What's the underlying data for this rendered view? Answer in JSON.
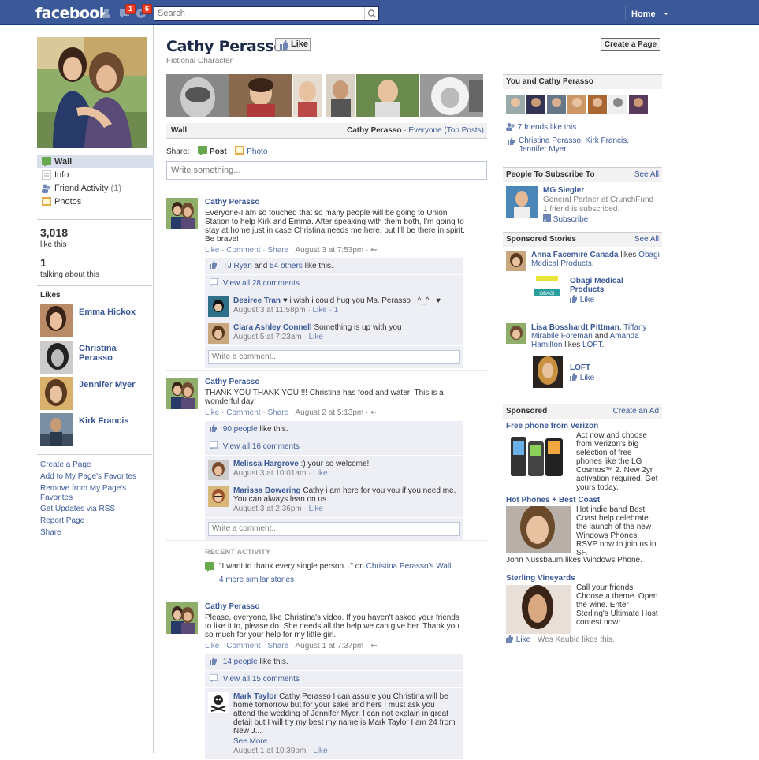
{
  "topbar": {
    "logo": "facebook",
    "badges": [
      "1",
      "6"
    ],
    "search_placeholder": "Search",
    "home": "Home"
  },
  "left": {
    "nav": [
      {
        "label": "Wall",
        "count": ""
      },
      {
        "label": "Info",
        "count": ""
      },
      {
        "label": "Friend Activity",
        "count": "(1)"
      },
      {
        "label": "Photos",
        "count": ""
      }
    ],
    "likes_count": "3,018",
    "likes_label": "like this",
    "talking_count": "1",
    "talking_label": "talking about this",
    "likes_heading": "Likes",
    "liked_pages": [
      "Emma Hickox",
      "Christina Perasso",
      "Jennifer Myer",
      "Kirk Francis"
    ],
    "links": [
      "Create a Page",
      "Add to My Page's Favorites",
      "Remove from My Page's Favorites",
      "Get Updates via RSS",
      "Report Page",
      "Share"
    ]
  },
  "header": {
    "name": "Cathy Perasso",
    "category": "Fictional Character",
    "like_button": "Like"
  },
  "wall": {
    "title": "Wall",
    "filter_name": "Cathy Perasso",
    "filter_sep": " · ",
    "filter_option": "Everyone (Top Posts)",
    "share_label": "Share:",
    "share_post": "Post",
    "share_photo": "Photo",
    "composer_placeholder": "Write something...",
    "write_comment": "Write a comment..."
  },
  "posts": [
    {
      "author": "Cathy Perasso",
      "text": "Everyone-I am so touched that so many people will be going to Union Station to help Kirk and Emma. After speaking with them both, I'm going to stay at home just in case Christina needs me here, but I'll be there in spirit. Be brave!",
      "actions": "Like · Comment · Share · ",
      "time": "August 3 at 7:53pm · ",
      "likes_a": "TJ Ryan",
      "likes_and": " and ",
      "likes_b": "54 others",
      "likes_tail": " like this.",
      "view_all": "View all 28 comments",
      "comments": [
        {
          "author": "Desiree Tran",
          "text": " ♥ i wish i could hug you Ms. Perasso ~^_^~ ♥",
          "time": "August 3 at 11:58pm · ",
          "action": "Like",
          "extra": " · 1"
        },
        {
          "author": "Ciara Ashley Connell",
          "text": " Something is up with you",
          "time": "August 5 at 7:23am · ",
          "action": "Like",
          "extra": ""
        }
      ]
    },
    {
      "author": "Cathy Perasso",
      "text": "THANK YOU THANK YOU !!! Christina has food and water! This is a wonderful day!",
      "actions": "Like · Comment · Share · ",
      "time": "August 2 at 5:13pm · ",
      "likes_a": "90 people",
      "likes_tail": " like this.",
      "view_all": "View all 16 comments",
      "comments": [
        {
          "author": "Melissa Hargrove",
          "text": " :) your so welcome!",
          "time": "August 3 at 10:01am · ",
          "action": "Like",
          "extra": ""
        },
        {
          "author": "Marissa Bowering",
          "text": " Cathy i am here for you you if you need me. You can always lean on us.",
          "time": "August 3 at 2:36pm · ",
          "action": "Like",
          "extra": ""
        }
      ]
    },
    {
      "author": "Cathy Perasso",
      "text": "Please, everyone, like Christina's video. If you haven't asked your friends to like it to, please do. She needs all the help we can give her. Thank you so much for your help for my little girl.",
      "actions": "Like · Comment · Share · ",
      "time": "August 1 at 7:37pm · ",
      "likes_a": "14 people",
      "likes_tail": " like this.",
      "view_all": "View all 15 comments",
      "comments": [
        {
          "author": "Mark Taylor",
          "text": " Cathy Perasso I can assure you Christina will be home tomorrow but for your sake and hers I must ask you attend the wedding of Jennifer Myer. I can not explain in great detail but I will try my best my name is Mark Taylor I am 24 from New J...",
          "more": "See More",
          "time": "August 1 at 10:39pm · ",
          "action": "Like",
          "extra": ""
        }
      ]
    }
  ],
  "recent": {
    "heading": "RECENT ACTIVITY",
    "quote": "\"I want to thank every single person...\"",
    "on": " on ",
    "target": "Christina Perasso's Wall",
    "tail": ".",
    "more": "4 more similar stories"
  },
  "right": {
    "create_page": "Create a Page",
    "you_heading": "You and Cathy Perasso",
    "friends_like": "7 friends like this.",
    "friends_list": "Christina Perasso, Kirk Francis, Jennifer Myer",
    "subscribe_heading": "People To Subscribe To",
    "see_all": "See All",
    "sub_name": "MG Siegler",
    "sub_title": "General Partner at CrunchFund",
    "sub_friends": "1 friend is subscribed.",
    "sub_action": "Subscribe",
    "sponsored_stories_heading": "Sponsored Stories",
    "story1_name": "Anna Facemire Canada",
    "story1_likes": " likes ",
    "story1_page": "Obagi Medical Products",
    "story1_tail": ".",
    "obagi_title": "Obagi Medical Products",
    "obagi_logo": "OBAGI",
    "like": "Like",
    "story2_a": "Lisa Bosshardt Pittman",
    "story2_sep": ", ",
    "story2_b": "Tiffany Mirabile Foreman",
    "story2_and": " and ",
    "story2_c": "Amanda Hamilton",
    "story2_likes": " likes ",
    "story2_page": "LOFT",
    "story2_tail": ".",
    "loft_title": "LOFT",
    "sponsored_heading": "Sponsored",
    "create_ad": "Create an Ad",
    "ads": [
      {
        "title": "Free phone from Verizon",
        "text": "Act now and choose from Verizon's big selection of free phones like the LG Cosmos™ 2. New 2yr activation required. Get yours today."
      },
      {
        "title": "Hot Phones + Best Coast",
        "text": "Hot indie band Best Coast help celebrate the launch of the new Windows Phones. RSVP now to join us in SF.",
        "social": "John Nussbaum likes Windows Phone."
      },
      {
        "title": "Sterling Vineyards",
        "text": "Call your friends. Choose a theme. Open the wine. Enter Sterling's Ultimate Host contest now!",
        "social_like": "Like",
        "social_tail": " · Wes Kauble likes this."
      }
    ]
  },
  "colors": {
    "brand": "#3b5998",
    "link": "#3b5998",
    "badge": "#f03d25",
    "ufi_bg": "#edeff4"
  }
}
